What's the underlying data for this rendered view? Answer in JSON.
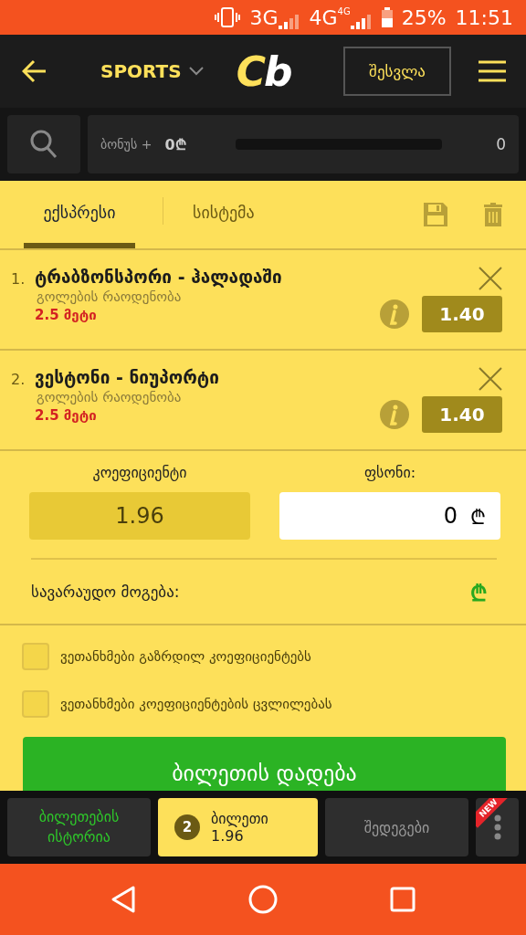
{
  "status_bar": {
    "network_1": "3G",
    "network_2": "4G",
    "network_2_badge": "4G",
    "battery": "25%",
    "time": "11:51"
  },
  "header": {
    "section": "SPORTS",
    "logo_left": "C",
    "logo_right": "b",
    "login": "შესვლა"
  },
  "bonus": {
    "label": "ბონუს +",
    "amount": "0₾",
    "count": "0"
  },
  "tabs": [
    {
      "label": "ექსპრესი",
      "selected": true
    },
    {
      "label": "სისტემა",
      "selected": false
    }
  ],
  "bets": [
    {
      "number": "1.",
      "match": "ტრაბზონსპორი - ჰალადაში",
      "market": "გოლების რაოდენობა",
      "pick": "2.5 მეტი",
      "odds": "1.40"
    },
    {
      "number": "2.",
      "match": "ვესტონი - ნიუპორტი",
      "market": "გოლების რაოდენობა",
      "pick": "2.5 მეტი",
      "odds": "1.40"
    }
  ],
  "summary": {
    "odds_label": "კოეფიციენტი",
    "odds_value": "1.96",
    "stake_label": "ფსონი:",
    "stake_value": "0",
    "stake_currency": "₾",
    "win_label": "სავარაუდო მოგება:",
    "win_currency": "₾"
  },
  "options": [
    {
      "label": "ვეთანხმები გაზრდილ კოეფიციენტებს",
      "checked": false
    },
    {
      "label": "ვეთანხმები კოეფიციენტების ცვლილებას",
      "checked": false
    }
  ],
  "place_button": "ბილეთის დადება",
  "bottom_nav": [
    {
      "kind": "history",
      "label": "ბილეთების ისტორია",
      "selected": false
    },
    {
      "kind": "ticket",
      "count": "2",
      "label": "ბილეთი",
      "value": "1.96",
      "selected": true
    },
    {
      "kind": "results",
      "label": "შედეგები",
      "selected": false
    },
    {
      "kind": "more",
      "badge": "NEW",
      "selected": false
    }
  ]
}
